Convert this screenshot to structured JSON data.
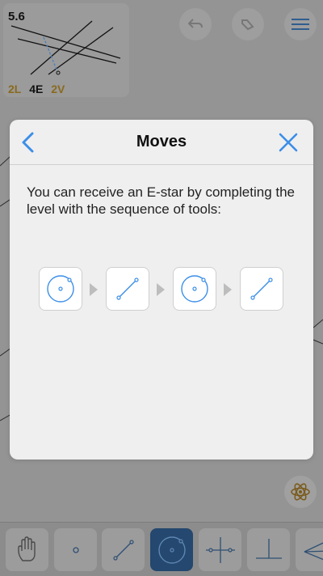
{
  "level": {
    "number": "5.6",
    "counts": [
      "2L",
      "4E",
      "2V"
    ]
  },
  "header_buttons": [
    {
      "icon": "undo-icon"
    },
    {
      "icon": "redo-icon"
    },
    {
      "icon": "menu-icon"
    }
  ],
  "toolbar": {
    "tools": [
      {
        "name": "hand",
        "icon": "hand-icon",
        "active": false
      },
      {
        "name": "point",
        "icon": "point-icon",
        "active": false
      },
      {
        "name": "line",
        "icon": "line-icon",
        "active": false
      },
      {
        "name": "circle",
        "icon": "circle-icon",
        "active": true
      },
      {
        "name": "perpendicular-bisector",
        "icon": "perpendicular-bisector-icon",
        "active": false
      },
      {
        "name": "perpendicular",
        "icon": "perpendicular-icon",
        "active": false
      },
      {
        "name": "angle-bisector",
        "icon": "angle-bisector-icon",
        "active": false
      }
    ]
  },
  "dialog": {
    "title": "Moves",
    "message": "You can receive an E-star by completing the level with the sequence of tools:",
    "sequence": [
      {
        "tool": "circle",
        "icon": "circle-icon"
      },
      {
        "tool": "line",
        "icon": "line-icon"
      },
      {
        "tool": "circle",
        "icon": "circle-icon"
      },
      {
        "tool": "line",
        "icon": "line-icon"
      }
    ]
  },
  "colors": {
    "accent": "#3b8ee8",
    "overlay": "#8f8f8f",
    "dialog_bg": "#efefef",
    "active_tool": "#24486f"
  }
}
